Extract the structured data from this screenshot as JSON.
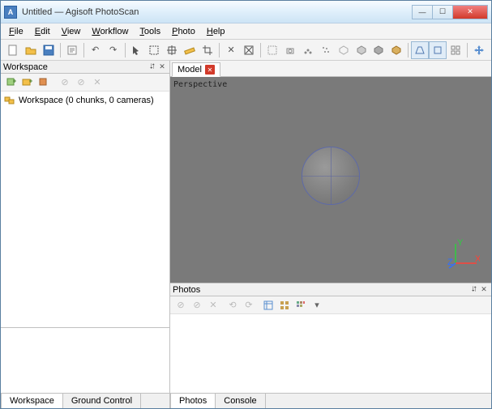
{
  "window": {
    "title": "Untitled — Agisoft PhotoScan"
  },
  "menu": {
    "file": "File",
    "edit": "Edit",
    "view": "View",
    "workflow": "Workflow",
    "tools": "Tools",
    "photo": "Photo",
    "help": "Help"
  },
  "workspace": {
    "panel_title": "Workspace",
    "root_label": "Workspace (0 chunks, 0 cameras)",
    "tab_workspace": "Workspace",
    "tab_ground": "Ground Control"
  },
  "model": {
    "tab_label": "Model",
    "perspective_label": "Perspective",
    "axis_x": "X",
    "axis_y": "Y",
    "axis_z": "Z"
  },
  "photos": {
    "panel_title": "Photos",
    "tab_photos": "Photos",
    "tab_console": "Console"
  }
}
